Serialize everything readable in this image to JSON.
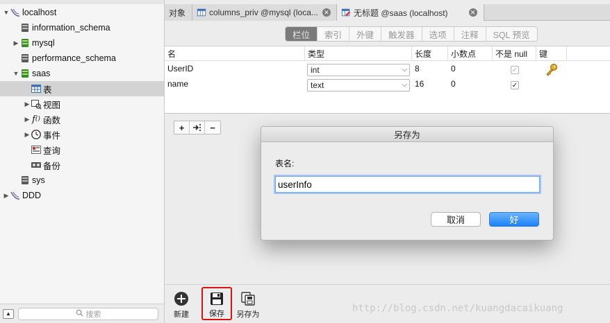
{
  "sidebar": {
    "items": [
      {
        "label": "localhost",
        "icon": "server-icon",
        "expanded": true,
        "level": 0
      },
      {
        "label": "information_schema",
        "icon": "database-icon",
        "level": 1
      },
      {
        "label": "mysql",
        "icon": "database-icon",
        "level": 1,
        "collapsed": true
      },
      {
        "label": "performance_schema",
        "icon": "database-icon",
        "level": 1
      },
      {
        "label": "saas",
        "icon": "database-icon",
        "level": 1,
        "expanded": true
      },
      {
        "label": "表",
        "icon": "table-icon",
        "level": 2,
        "selected": true
      },
      {
        "label": "视图",
        "icon": "view-icon",
        "level": 2
      },
      {
        "label": "函数",
        "icon": "function-icon",
        "level": 2
      },
      {
        "label": "事件",
        "icon": "event-clock-icon",
        "level": 2
      },
      {
        "label": "查询",
        "icon": "query-icon",
        "level": 2
      },
      {
        "label": "备份",
        "icon": "backup-icon",
        "level": 2
      },
      {
        "label": "sys",
        "icon": "database-icon",
        "level": 1
      },
      {
        "label": "DDD",
        "icon": "server-icon",
        "level": 0
      }
    ],
    "search_placeholder": "搜索"
  },
  "tabs": [
    {
      "label": "对象"
    },
    {
      "label": "columns_priv @mysql (loca..."
    },
    {
      "label": "无标题 @saas (localhost)",
      "active": true
    }
  ],
  "segments": [
    "栏位",
    "索引",
    "外键",
    "触发器",
    "选项",
    "注释",
    "SQL 预览"
  ],
  "fields": {
    "headers": [
      "名",
      "类型",
      "长度",
      "小数点",
      "不是 null",
      "键"
    ],
    "rows": [
      {
        "name": "UserID",
        "type": "int",
        "length": "8",
        "decimals": "0",
        "not_null": true,
        "key": true
      },
      {
        "name": "name",
        "type": "text",
        "length": "16",
        "decimals": "0",
        "not_null": true,
        "key": false
      }
    ]
  },
  "toolbar": {
    "new_label": "新建",
    "save_label": "保存",
    "saveas_label": "另存为"
  },
  "watermark": "http://blog.csdn.net/kuangdacaikuang",
  "dialog": {
    "title": "另存为",
    "label": "表名:",
    "value": "userInfo",
    "cancel_label": "取消",
    "ok_label": "好"
  },
  "colors": {
    "ok_button": "#1a82fb",
    "selected_row": "#d3d3d3",
    "save_highlight": "#dd1111"
  }
}
